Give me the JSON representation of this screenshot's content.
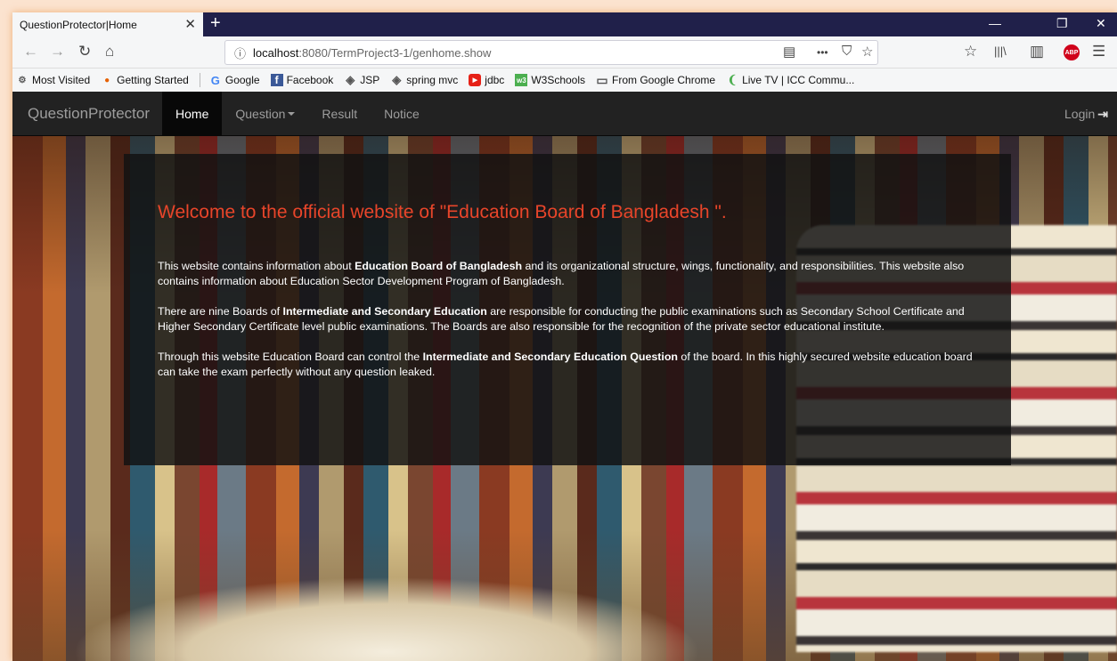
{
  "browser": {
    "tab_title": "QuestionProtector|Home",
    "tab_close": "✕",
    "new_tab": "+",
    "url_host": "localhost",
    "url_rest": ":8080/TermProject3-1/genhome.show",
    "url_info_icon": "ⓘ",
    "window_controls": {
      "minimize": "—",
      "restore": "❐",
      "close": "✕"
    },
    "toolbar_icons": {
      "back": "←",
      "forward": "→",
      "reload": "↻",
      "home": "⌂",
      "reader": "▤",
      "more": "•••",
      "pocket": "⛉",
      "star": "☆",
      "library": "|||\\",
      "sidebar": "▥",
      "abp": "ABP",
      "menu": "☰",
      "bookmarks": "☆"
    },
    "bookmarks": [
      {
        "label": "Most Visited",
        "icon": "⚙",
        "color": "#555555"
      },
      {
        "label": "Getting Started",
        "icon": "●",
        "color": "#e66000"
      },
      {
        "label": "Google",
        "icon": "G",
        "color": "#4285f4"
      },
      {
        "label": "Facebook",
        "icon": "f",
        "color": "#3b5998"
      },
      {
        "label": "JSP",
        "icon": "◈",
        "color": "#555555"
      },
      {
        "label": "spring mvc",
        "icon": "◈",
        "color": "#555555"
      },
      {
        "label": "jdbc",
        "icon": "▶",
        "color": "#e62117"
      },
      {
        "label": "W3Schools",
        "icon": "w3",
        "color": "#4caf50"
      },
      {
        "label": "From Google Chrome",
        "icon": "▭",
        "color": "#555555"
      },
      {
        "label": "Live TV | ICC Commu...",
        "icon": "❨",
        "color": "#4caf50"
      }
    ]
  },
  "navbar": {
    "brand": "QuestionProtector",
    "links": {
      "home": "Home",
      "question": "Question",
      "result": "Result",
      "notice": "Notice"
    },
    "login": "Login",
    "login_icon": "⇥"
  },
  "jumbotron": {
    "heading": "Welcome to the official website of \"Education Board of Bangladesh \".",
    "p1": {
      "a": "This website contains information about ",
      "b": "Education Board of Bangladesh",
      "c": " and its organizational structure, wings, functionality, and responsibilities. This website also contains information about Education Sector Development Program of Bangladesh."
    },
    "p2": {
      "a": "There are nine Boards of ",
      "b": "Intermediate and Secondary Education",
      "c": " are responsible for conducting the public examinations such as Secondary School Certificate and Higher Secondary Certificate level public examinations. The Boards are also responsible for the recognition of the private sector educational institute."
    },
    "p3": {
      "a": "Through this website Education Board can control the ",
      "b": "Intermediate and Secondary Education Question",
      "c": " of the board. In this highly secured website education board can take the exam perfectly without any question leaked."
    }
  },
  "colors": {
    "heading": "#e8452a",
    "navbar": "#222222",
    "tabstrip": "#20204a"
  }
}
